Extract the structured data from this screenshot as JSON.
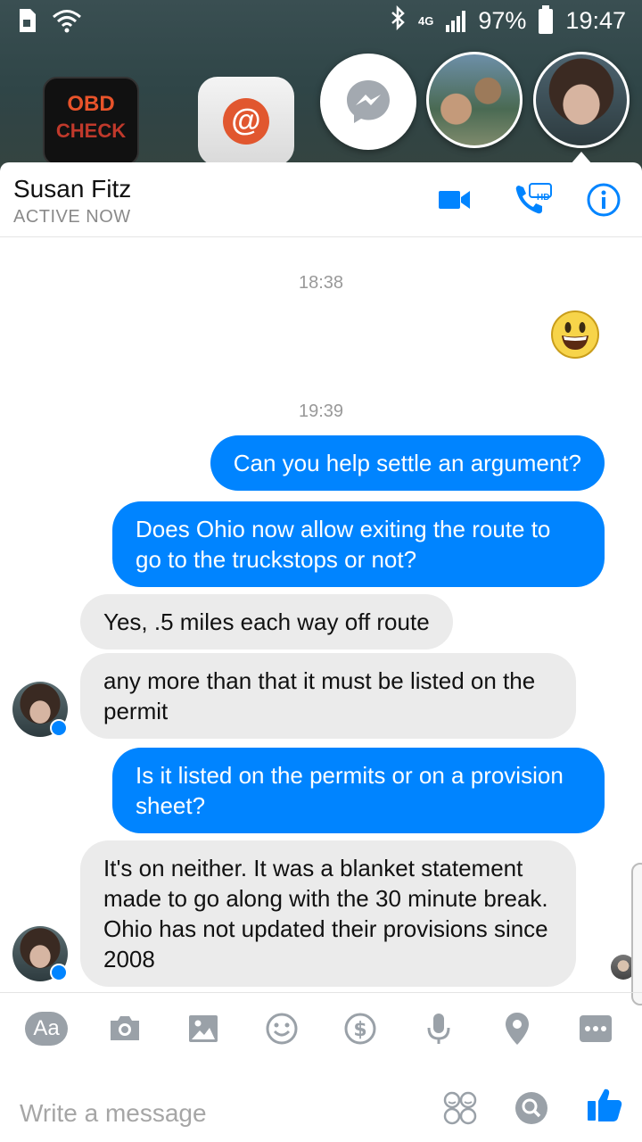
{
  "status_bar": {
    "network": "4G",
    "battery_percent": "97%",
    "time": "19:47"
  },
  "home_apps": {
    "obd_label": "OBD",
    "obd_sub": "CHECK",
    "email_symbol": "@"
  },
  "header": {
    "contact_name": "Susan Fitz",
    "status": "ACTIVE NOW",
    "call_badge": "HD"
  },
  "messages": [
    {
      "type": "timestamp",
      "text": "18:38"
    },
    {
      "type": "emoji",
      "direction": "outgoing",
      "icon": "grinning-face-emoji"
    },
    {
      "type": "timestamp",
      "text": "19:39"
    },
    {
      "type": "text",
      "direction": "outgoing",
      "text": "Can you help settle an argument?"
    },
    {
      "type": "text",
      "direction": "outgoing",
      "text": "Does Ohio now allow exiting the route to go to the truckstops or not?"
    },
    {
      "type": "text",
      "direction": "incoming",
      "text": "Yes, .5 miles each way off route"
    },
    {
      "type": "text",
      "direction": "incoming",
      "text": "any more than that it must be listed on the permit"
    },
    {
      "type": "text",
      "direction": "outgoing",
      "text": "Is it listed on the permits or on a provision sheet?"
    },
    {
      "type": "text",
      "direction": "incoming",
      "text": "It's on neither. It was a blanket statement made to go along with the 30 minute break. Ohio has not updated their provisions since 2008"
    }
  ],
  "toolbar": {
    "text_label": "Aa",
    "icons": [
      "camera-icon",
      "gallery-icon",
      "emoji-icon",
      "payment-icon",
      "microphone-icon",
      "location-icon",
      "more-icon"
    ]
  },
  "composer": {
    "placeholder": "Write a message"
  },
  "colors": {
    "accent": "#0084ff",
    "incoming_bubble": "#ebebeb",
    "muted_text": "#8a8a8a"
  }
}
